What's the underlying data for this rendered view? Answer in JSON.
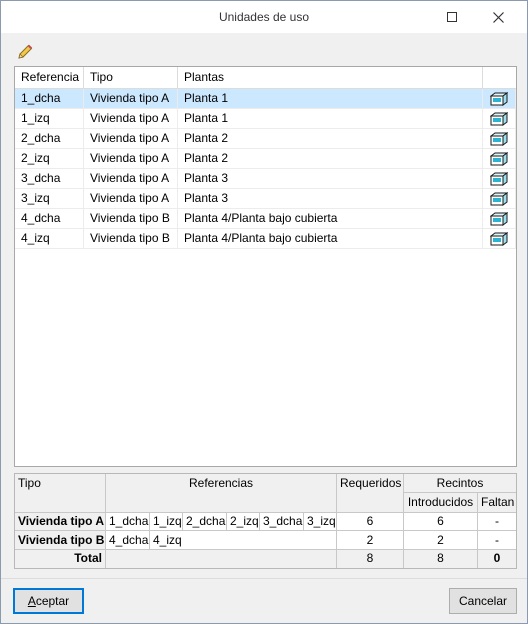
{
  "window": {
    "title": "Unidades de uso"
  },
  "toolbar": {
    "edit_icon": "pencil-icon"
  },
  "grid": {
    "columns": [
      "Referencia",
      "Tipo",
      "Plantas",
      ""
    ],
    "rows": [
      {
        "ref": "1_dcha",
        "tipo": "Vivienda tipo A",
        "plantas": "Planta 1",
        "selected": true
      },
      {
        "ref": "1_izq",
        "tipo": "Vivienda tipo A",
        "plantas": "Planta 1"
      },
      {
        "ref": "2_dcha",
        "tipo": "Vivienda tipo A",
        "plantas": "Planta 2"
      },
      {
        "ref": "2_izq",
        "tipo": "Vivienda tipo A",
        "plantas": "Planta 2"
      },
      {
        "ref": "3_dcha",
        "tipo": "Vivienda tipo A",
        "plantas": "Planta 3"
      },
      {
        "ref": "3_izq",
        "tipo": "Vivienda tipo A",
        "plantas": "Planta 3"
      },
      {
        "ref": "4_dcha",
        "tipo": "Vivienda tipo B",
        "plantas": "Planta 4/Planta bajo cubierta"
      },
      {
        "ref": "4_izq",
        "tipo": "Vivienda tipo B",
        "plantas": "Planta 4/Planta bajo cubierta"
      }
    ],
    "row_icon": "room-box-icon"
  },
  "summary": {
    "headers": {
      "tipo": "Tipo",
      "referencias": "Referencias",
      "requeridos": "Requeridos",
      "recintos": "Recintos",
      "introducidos": "Introducidos",
      "faltan": "Faltan"
    },
    "rows": [
      {
        "tipo": "Vivienda tipo A",
        "refs": [
          "1_dcha",
          "1_izq",
          "2_dcha",
          "2_izq",
          "3_dcha",
          "3_izq"
        ],
        "requeridos": "6",
        "introducidos": "6",
        "faltan": "-"
      },
      {
        "tipo": "Vivienda tipo B",
        "refs": [
          "4_dcha",
          "4_izq"
        ],
        "requeridos": "2",
        "introducidos": "2",
        "faltan": "-"
      }
    ],
    "total": {
      "label": "Total",
      "requeridos": "8",
      "introducidos": "8",
      "faltan": "0"
    }
  },
  "buttons": {
    "accept_first": "A",
    "accept_rest": "ceptar",
    "cancel": "Cancelar"
  },
  "colors": {
    "selection": "#cce8ff",
    "accent": "#0078d7"
  }
}
